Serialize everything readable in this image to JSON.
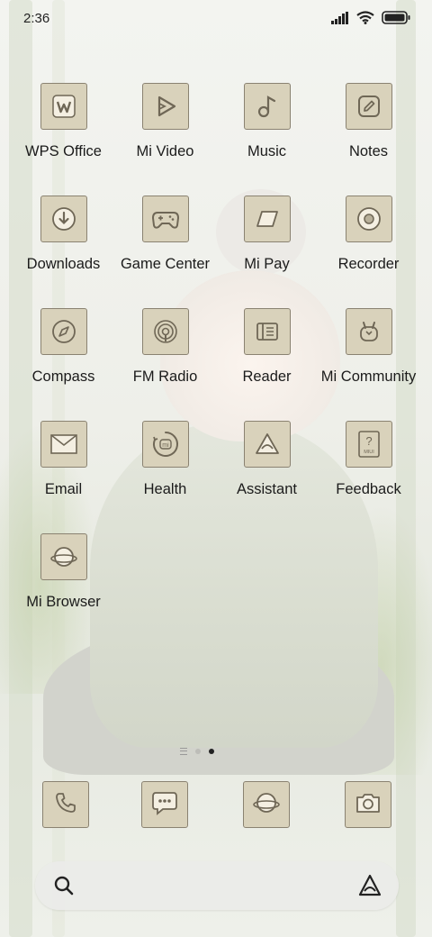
{
  "status_bar": {
    "time": "2:36"
  },
  "apps": [
    {
      "label": "WPS Office",
      "icon": "wps-office-icon"
    },
    {
      "label": "Mi Video",
      "icon": "play-icon"
    },
    {
      "label": "Music",
      "icon": "music-note-icon"
    },
    {
      "label": "Notes",
      "icon": "pencil-icon"
    },
    {
      "label": "Downloads",
      "icon": "download-icon"
    },
    {
      "label": "Game Center",
      "icon": "gamepad-icon"
    },
    {
      "label": "Mi Pay",
      "icon": "card-icon"
    },
    {
      "label": "Recorder",
      "icon": "record-icon"
    },
    {
      "label": "Compass",
      "icon": "compass-icon"
    },
    {
      "label": "FM Radio",
      "icon": "radio-icon"
    },
    {
      "label": "Reader",
      "icon": "book-icon"
    },
    {
      "label": "Mi Community",
      "icon": "bunny-icon"
    },
    {
      "label": "Email",
      "icon": "envelope-icon"
    },
    {
      "label": "Health",
      "icon": "health-ring-icon"
    },
    {
      "label": "Assistant",
      "icon": "assistant-icon"
    },
    {
      "label": "Feedback",
      "icon": "question-icon"
    },
    {
      "label": "Mi Browser",
      "icon": "planet-icon"
    }
  ],
  "dock": [
    {
      "icon": "phone-icon"
    },
    {
      "icon": "message-icon"
    },
    {
      "icon": "planet-icon"
    },
    {
      "icon": "camera-icon"
    }
  ],
  "feedback_badge_text": "MIUI",
  "health_badge_text": "mi",
  "colors": {
    "icon_bg": "#d9d2bb",
    "icon_border": "#8a8271",
    "icon_stroke": "#6f6756",
    "label": "#1b1b1b"
  }
}
